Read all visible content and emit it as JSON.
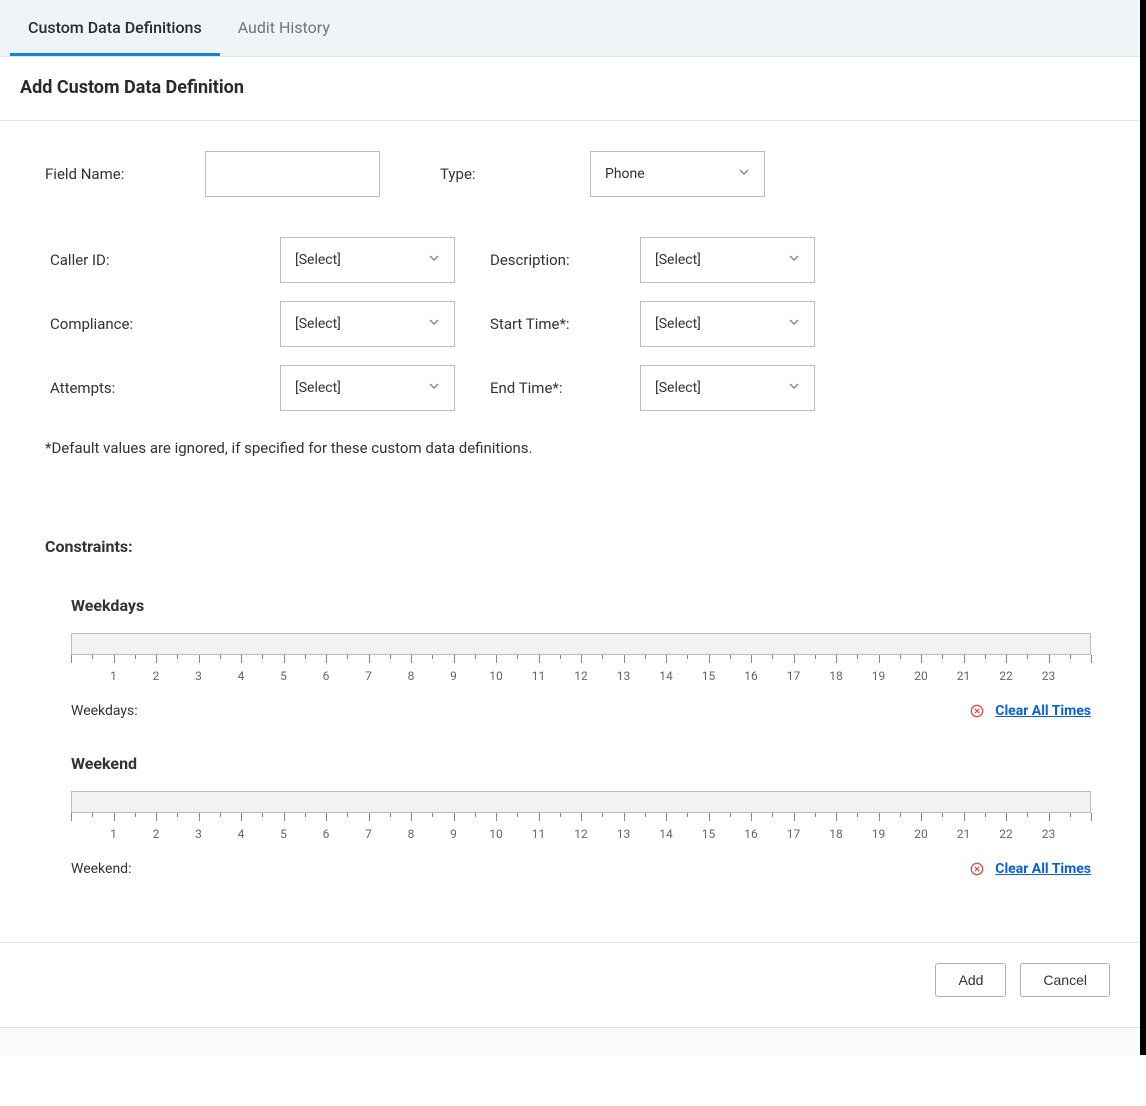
{
  "tabs": {
    "custom": "Custom Data Definitions",
    "audit": "Audit History"
  },
  "page_title": "Add Custom Data Definition",
  "form": {
    "field_name_label": "Field Name:",
    "field_name_value": "",
    "type_label": "Type:",
    "type_value": "Phone",
    "caller_id_label": "Caller ID:",
    "caller_id_value": "[Select]",
    "description_label": "Description:",
    "description_value": "[Select]",
    "compliance_label": "Compliance:",
    "compliance_value": "[Select]",
    "start_time_label": "Start Time*:",
    "start_time_value": "[Select]",
    "attempts_label": "Attempts:",
    "attempts_value": "[Select]",
    "end_time_label": "End Time*:",
    "end_time_value": "[Select]",
    "note": "*Default values are ignored, if specified for these custom data definitions."
  },
  "constraints": {
    "title": "Constraints:",
    "weekdays_title": "Weekdays",
    "weekdays_footer": "Weekdays:",
    "weekend_title": "Weekend",
    "weekend_footer": "Weekend:",
    "clear_link": "Clear All Times",
    "hours": [
      "1",
      "2",
      "3",
      "4",
      "5",
      "6",
      "7",
      "8",
      "9",
      "10",
      "11",
      "12",
      "13",
      "14",
      "15",
      "16",
      "17",
      "18",
      "19",
      "20",
      "21",
      "22",
      "23"
    ]
  },
  "actions": {
    "add": "Add",
    "cancel": "Cancel"
  }
}
